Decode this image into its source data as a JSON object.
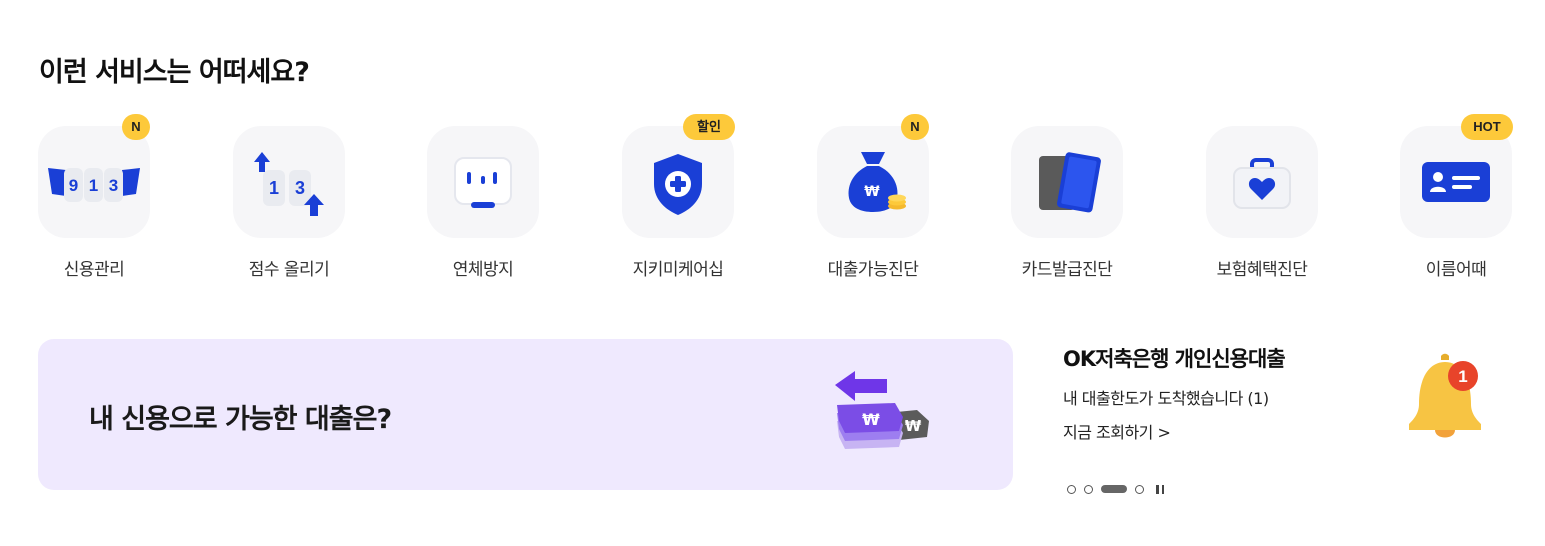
{
  "section_title": "이런 서비스는 어떠세요?",
  "services": [
    {
      "label": "신용관리",
      "badge": "N"
    },
    {
      "label": "점수 올리기",
      "badge": ""
    },
    {
      "label": "연체방지",
      "badge": ""
    },
    {
      "label": "지키미케어십",
      "badge": "할인"
    },
    {
      "label": "대출가능진단",
      "badge": "N"
    },
    {
      "label": "카드발급진단",
      "badge": ""
    },
    {
      "label": "보험혜택진단",
      "badge": ""
    },
    {
      "label": "이름어때",
      "badge": "HOT"
    }
  ],
  "service_icons": [
    "slot-913-icon",
    "score-up-icon",
    "calendar-face-icon",
    "shield-plus-icon",
    "money-bag-icon",
    "cards-icon",
    "insurance-bag-icon",
    "id-card-icon"
  ],
  "banner": {
    "text": "내 신용으로 가능한 대출은?",
    "icon": "won-transfer-icon"
  },
  "notice": {
    "title": "OK저축은행 개인신용대출",
    "description": "내 대출한도가 도착했습니다 (1)",
    "link": "지금 조회하기 >",
    "bell_count": "1"
  },
  "slot_digits": [
    "9",
    "1",
    "3"
  ],
  "score_digits": [
    "1",
    "3"
  ],
  "carousel": {
    "total": 4,
    "active": 3
  },
  "colors": {
    "badge": "#fdc93a",
    "banner_bg": "#efe9fe",
    "brand_blue": "#1a3fd6",
    "bell": "#f7c443",
    "bell_badge": "#e8442a"
  }
}
